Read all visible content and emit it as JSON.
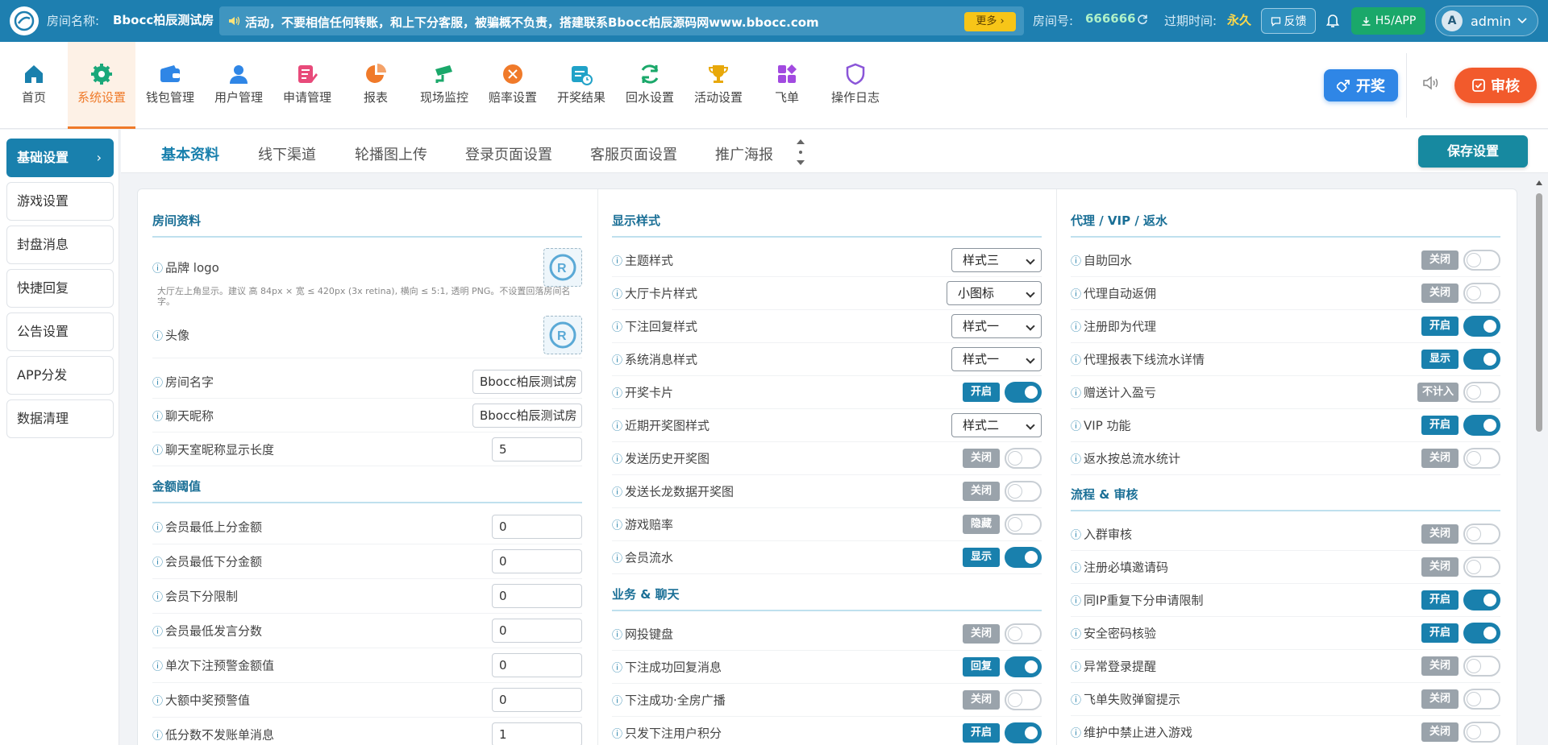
{
  "topbar": {
    "room_label": "房间名称:",
    "room_name": "Bbocc柏辰测试房",
    "notice": "活动，不要相信任何转账，和上下分客服，被骗概不负责，搭建联系Bbocc柏辰源码网www.bbocc.com",
    "more_label": "更多 ›",
    "roomno_label": "房间号:",
    "roomno": "666666",
    "expire_label": "过期时间:",
    "expire": "永久",
    "feedback_label": "反馈",
    "h5app_label": "H5/APP",
    "avatar_letter": "A",
    "username": "admin"
  },
  "nav": {
    "items": [
      {
        "label": "首页",
        "icon": "home-icon",
        "color": "#1980ad"
      },
      {
        "label": "系统设置",
        "icon": "gear-icon",
        "color": "#1aa87a"
      },
      {
        "label": "钱包管理",
        "icon": "wallet-icon",
        "color": "#2f86e6"
      },
      {
        "label": "用户管理",
        "icon": "user-icon",
        "color": "#2f86e6"
      },
      {
        "label": "申请管理",
        "icon": "form-icon",
        "color": "#e84a7a"
      },
      {
        "label": "报表",
        "icon": "pie-chart-icon",
        "color": "#f07a2a"
      },
      {
        "label": "现场监控",
        "icon": "camera-icon",
        "color": "#1aa86a"
      },
      {
        "label": "赔率设置",
        "icon": "odds-icon",
        "color": "#f07a2a"
      },
      {
        "label": "开奖结果",
        "icon": "calendar-icon",
        "color": "#21a2c8"
      },
      {
        "label": "回水设置",
        "icon": "refresh-icon",
        "color": "#1aa86a"
      },
      {
        "label": "活动设置",
        "icon": "trophy-icon",
        "color": "#e8a80a"
      },
      {
        "label": "飞单",
        "icon": "grid-icon",
        "color": "#a24ae0"
      },
      {
        "label": "操作日志",
        "icon": "shield-icon",
        "color": "#8a55d8"
      }
    ],
    "draw_label": "开奖",
    "review_label": "审核"
  },
  "sidebar": {
    "items": [
      "基础设置",
      "游戏设置",
      "封盘消息",
      "快捷回复",
      "公告设置",
      "APP分发",
      "数据清理"
    ],
    "active_arrow": "›"
  },
  "tabs": {
    "items": [
      "基本资料",
      "线下渠道",
      "轮播图上传",
      "登录页面设置",
      "客服页面设置",
      "推广海报"
    ],
    "save_label": "保存设置"
  },
  "col1": {
    "sec_room": "房间资料",
    "brand_logo": "品牌 logo",
    "brand_hint": "大厅左上角显示。建议 高 84px × 宽 ≤ 420px (3x retina), 横向 ≤ 5:1, 透明 PNG。不设置回落房间名字。",
    "avatar": "头像",
    "room_name": "房间名字",
    "room_name_val": "Bbocc柏辰测试房",
    "chat_nick": "聊天昵称",
    "chat_nick_val": "Bbocc柏辰测试房",
    "nick_len": "聊天室昵称显示长度",
    "nick_len_val": "5",
    "sec_amount": "金额阈值",
    "rows": [
      {
        "label": "会员最低上分金额",
        "value": "0"
      },
      {
        "label": "会员最低下分金额",
        "value": "0"
      },
      {
        "label": "会员下分限制",
        "value": "0"
      },
      {
        "label": "会员最低发言分数",
        "value": "0"
      },
      {
        "label": "单次下注预警金额值",
        "value": "0"
      },
      {
        "label": "大额中奖预警值",
        "value": "0"
      },
      {
        "label": "低分数不发账单消息",
        "value": "1"
      }
    ]
  },
  "col2": {
    "sec_display": "显示样式",
    "rows": [
      {
        "label": "主题样式",
        "type": "select",
        "value": "样式三"
      },
      {
        "label": "大厅卡片样式",
        "type": "select",
        "value": "小图标"
      },
      {
        "label": "下注回复样式",
        "type": "select",
        "value": "样式一"
      },
      {
        "label": "系统消息样式",
        "type": "select",
        "value": "样式一"
      },
      {
        "label": "开奖卡片",
        "type": "toggle",
        "badge": "开启",
        "on": true
      },
      {
        "label": "近期开奖图样式",
        "type": "select",
        "value": "样式二"
      },
      {
        "label": "发送历史开奖图",
        "type": "toggle",
        "badge": "关闭",
        "on": false
      },
      {
        "label": "发送长龙数据开奖图",
        "type": "toggle",
        "badge": "关闭",
        "on": false
      },
      {
        "label": "游戏赔率",
        "type": "toggle",
        "badge": "隐藏",
        "on": false
      },
      {
        "label": "会员流水",
        "type": "toggle",
        "badge": "显示",
        "on": true
      }
    ],
    "sec_biz": "业务 & 聊天",
    "rows2": [
      {
        "label": "网投键盘",
        "badge": "关闭",
        "on": false
      },
      {
        "label": "下注成功回复消息",
        "badge": "回复",
        "on": true
      },
      {
        "label": "下注成功·全房广播",
        "badge": "关闭",
        "on": false
      },
      {
        "label": "只发下注用户积分",
        "badge": "开启",
        "on": true
      }
    ]
  },
  "col3": {
    "sec_agent": "代理 / VIP / 返水",
    "rows": [
      {
        "label": "自助回水",
        "badge": "关闭",
        "on": false
      },
      {
        "label": "代理自动返佣",
        "badge": "关闭",
        "on": false
      },
      {
        "label": "注册即为代理",
        "badge": "开启",
        "on": true
      },
      {
        "label": "代理报表下线流水详情",
        "badge": "显示",
        "on": true
      },
      {
        "label": "赠送计入盈亏",
        "badge": "不计入",
        "on": false
      },
      {
        "label": "VIP 功能",
        "badge": "开启",
        "on": true
      },
      {
        "label": "返水按总流水统计",
        "badge": "关闭",
        "on": false
      }
    ],
    "sec_flow": "流程 & 审核",
    "rows2": [
      {
        "label": "入群审核",
        "badge": "关闭",
        "on": false
      },
      {
        "label": "注册必填邀请码",
        "badge": "关闭",
        "on": false
      },
      {
        "label": "同IP重复下分申请限制",
        "badge": "开启",
        "on": true
      },
      {
        "label": "安全密码核验",
        "badge": "开启",
        "on": true
      },
      {
        "label": "异常登录提醒",
        "badge": "关闭",
        "on": false
      },
      {
        "label": "飞单失败弹窗提示",
        "badge": "关闭",
        "on": false
      },
      {
        "label": "维护中禁止进入游戏",
        "badge": "关闭",
        "on": false
      }
    ]
  },
  "info_mark": "ⓘ"
}
